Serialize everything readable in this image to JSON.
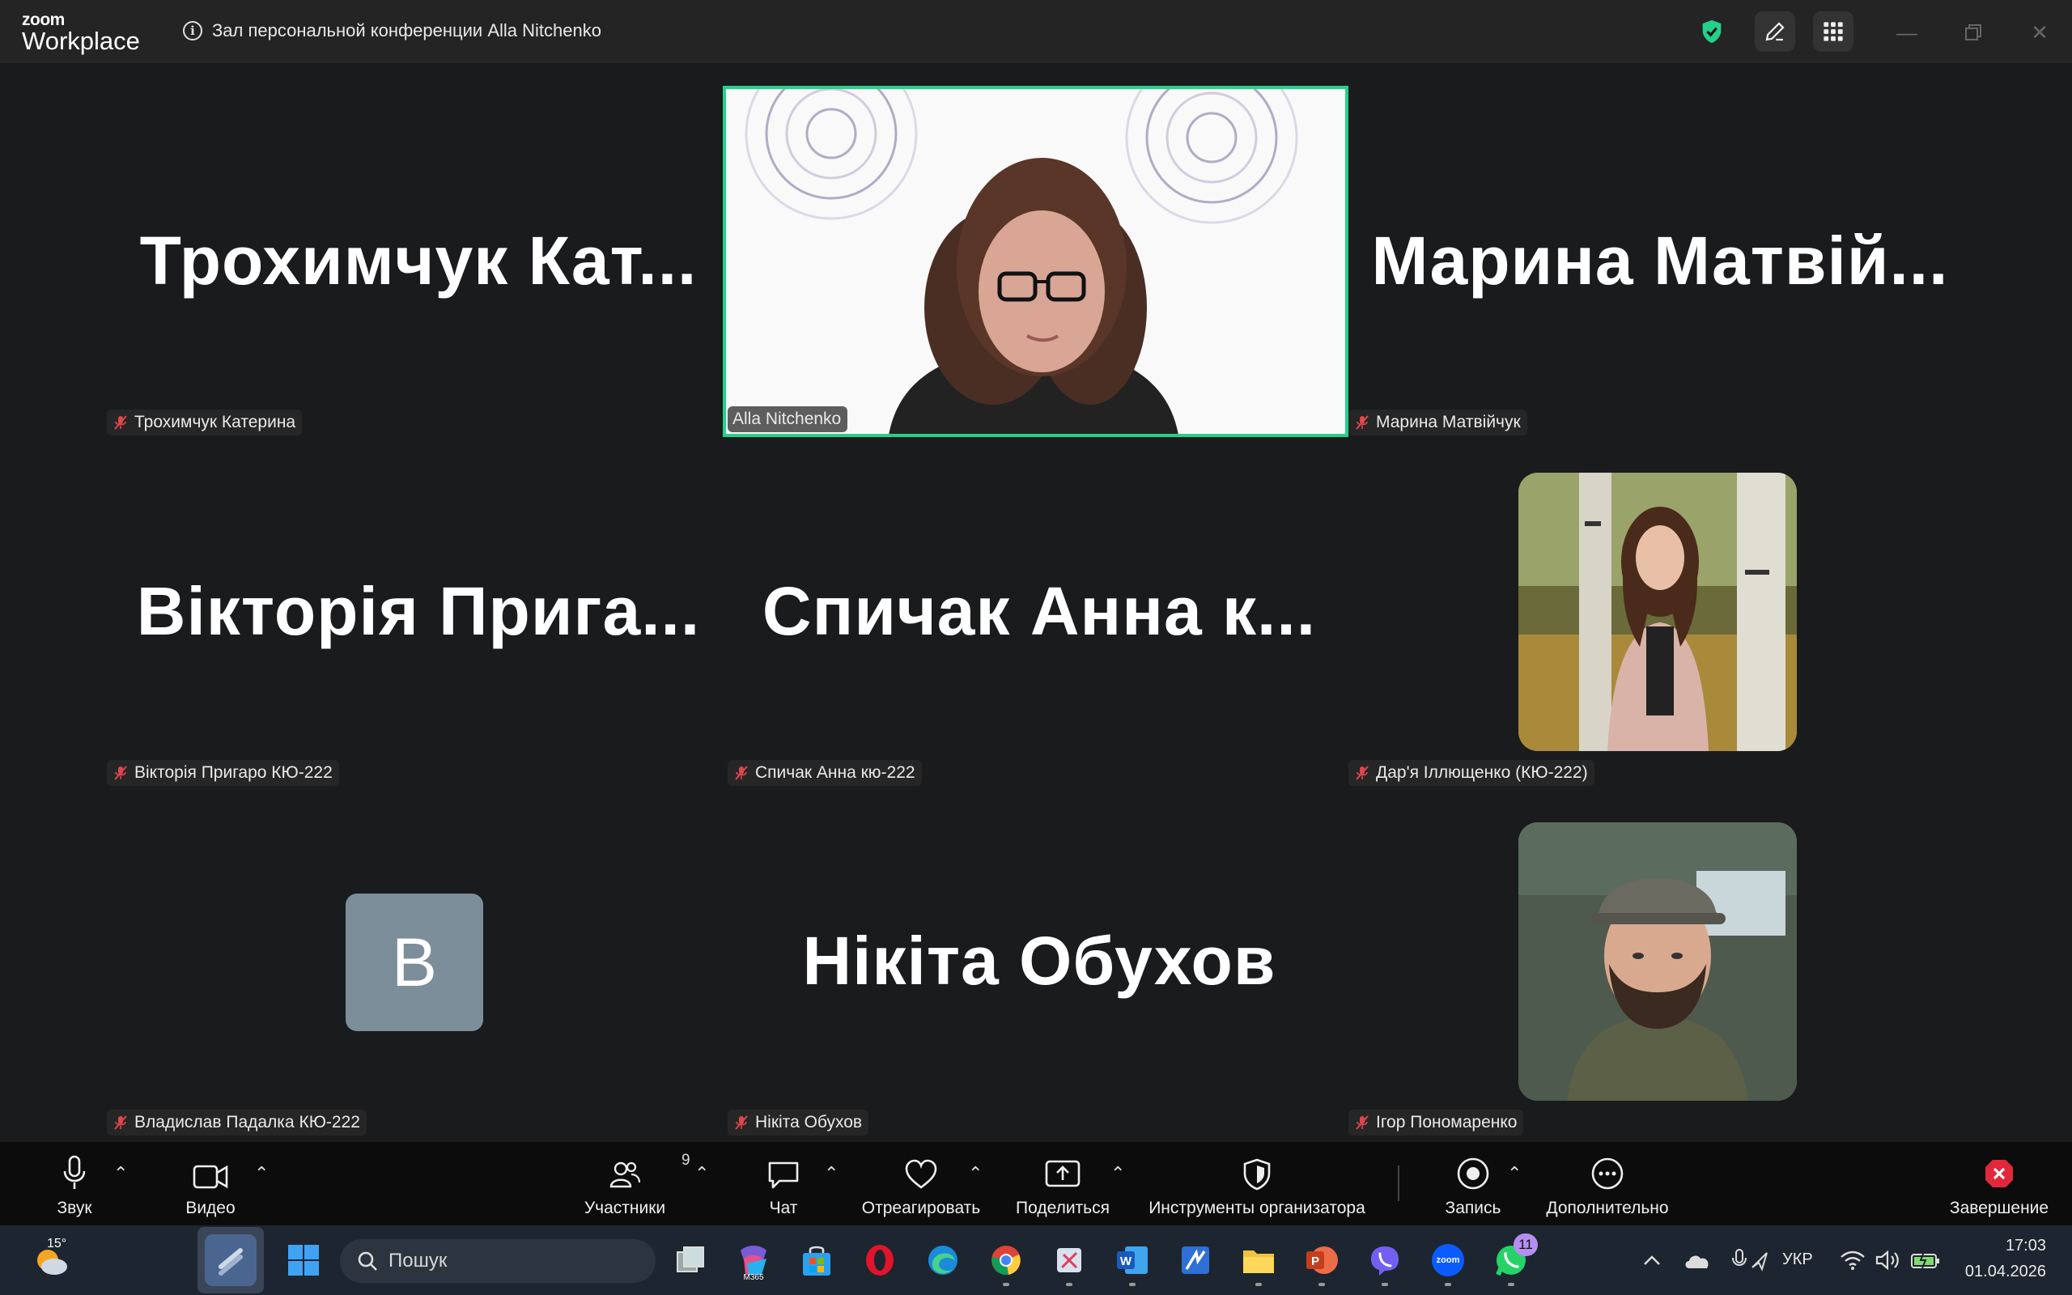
{
  "app": {
    "logo_top": "zoom",
    "logo_bottom": "Workplace",
    "meeting_title": "Зал персональной конференции Alla Nitchenko",
    "icons": {
      "security": "shield-check-icon",
      "annotate": "pencil-icon",
      "apps": "grid-icon",
      "minimize": "minimize-icon",
      "maximize": "restore-icon",
      "close": "close-icon"
    },
    "accent_color": "#23d18b"
  },
  "participants": [
    {
      "display_name": "Трохимчук  Кат...",
      "label": "Трохимчук Катерина",
      "muted": true
    },
    {
      "display_name": "",
      "label": "Alla Nitchenko",
      "muted": false,
      "video_on": true,
      "active_speaker": true
    },
    {
      "display_name": "Марина  Матвій...",
      "label": "Марина Матвійчук",
      "muted": true
    },
    {
      "display_name": "Вікторія  Прига...",
      "label": "Вікторія Пригаро КЮ-222",
      "muted": true
    },
    {
      "display_name": "Спичак  Анна  к...",
      "label": "Спичак Анна кю-222",
      "muted": true
    },
    {
      "display_name": "",
      "label": "Дар'я Іллющенко (КЮ-222)",
      "muted": true,
      "profile_photo": true
    },
    {
      "display_name": "",
      "avatar_letter": "B",
      "label": "Владислав Падалка КЮ-222",
      "muted": true
    },
    {
      "display_name": "Нікіта Обухов",
      "label": "Нікіта Обухов",
      "muted": true
    },
    {
      "display_name": "",
      "label": "Ігор Пономаренко",
      "muted": true,
      "profile_photo": true
    }
  ],
  "toolbar": {
    "audio": "Звук",
    "video": "Видео",
    "participants": "Участники",
    "participants_count": "9",
    "chat": "Чат",
    "react": "Отреагировать",
    "share": "Поделиться",
    "host_tools": "Инструменты организатора",
    "record": "Запись",
    "more": "Дополнительно",
    "end": "Завершение"
  },
  "taskbar": {
    "weather_temp": "15°",
    "search_placeholder": "Пошук",
    "m365_label": "M365",
    "zoom_app_label": "zoom",
    "whatsapp_badge": "11",
    "language": "УКР",
    "time": "17:03",
    "date": "01.04.2026"
  }
}
